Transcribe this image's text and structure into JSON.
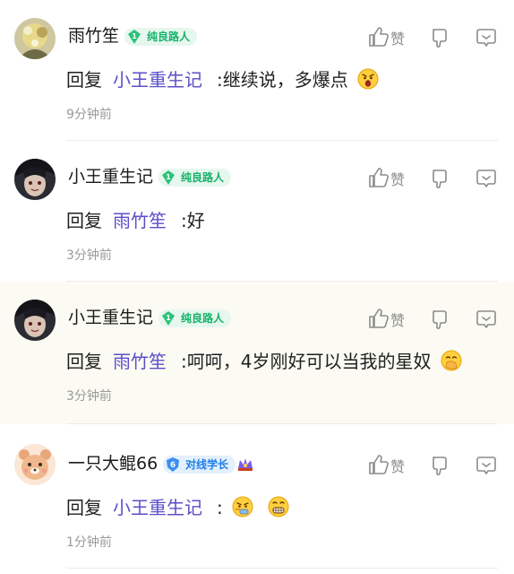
{
  "comments": [
    {
      "username": "雨竹笙",
      "badge": {
        "level": "1",
        "title": "纯良路人",
        "color": "green"
      },
      "like_label": "赞",
      "reply_prefix": "回复",
      "reply_target": "小王重生记",
      "text": ":继续说，多爆点",
      "time": "9分钟前"
    },
    {
      "username": "小王重生记",
      "badge": {
        "level": "1",
        "title": "纯良路人",
        "color": "green"
      },
      "like_label": "赞",
      "reply_prefix": "回复",
      "reply_target": "雨竹笙",
      "text": ":好",
      "time": "3分钟前"
    },
    {
      "username": "小王重生记",
      "badge": {
        "level": "1",
        "title": "纯良路人",
        "color": "green"
      },
      "like_label": "赞",
      "reply_prefix": "回复",
      "reply_target": "雨竹笙",
      "text": ":呵呵，4岁刚好可以当我的星奴",
      "time": "3分钟前"
    },
    {
      "username": "一只大鲲66",
      "badge": {
        "level": "6",
        "title": "对线学长",
        "color": "blue"
      },
      "like_label": "赞",
      "reply_prefix": "回复",
      "reply_target": "小王重生记",
      "text": ":",
      "time": "1分钟前"
    }
  ],
  "colors": {
    "accent_link": "#5a4fc9",
    "badge_green": "#17b26a",
    "badge_blue": "#1d7de8",
    "muted": "#9a9a9a"
  },
  "icons": [
    "thumbs-up-icon",
    "thumbs-down-icon",
    "reply-bubble-icon",
    "emoji"
  ]
}
